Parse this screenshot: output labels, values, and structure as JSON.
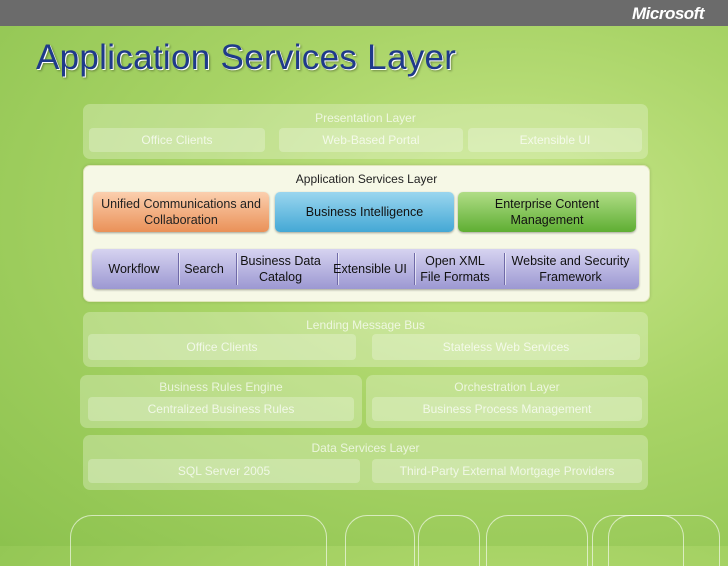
{
  "brand": "Microsoft",
  "title": "Application Services Layer",
  "presentation_layer": {
    "title": "Presentation Layer",
    "items": [
      "Office Clients",
      "Web-Based Portal",
      "Extensible UI"
    ]
  },
  "app_services": {
    "title": "Application Services Layer",
    "top_boxes": [
      "Unified Communications and Collaboration",
      "Business Intelligence",
      "Enterprise Content Management"
    ],
    "strip_items": [
      "Workflow",
      "Search",
      "Business Data Catalog",
      "Extensible UI",
      "Open XML File Formats",
      "Website and Security Framework"
    ]
  },
  "lending_bus": {
    "title": "Lending Message Bus",
    "items": [
      "Office Clients",
      "Stateless Web Services"
    ]
  },
  "business_rules": {
    "title": "Business Rules Engine",
    "item": "Centralized Business Rules"
  },
  "orchestration": {
    "title": "Orchestration Layer",
    "item": "Business Process Management"
  },
  "data_services": {
    "title": "Data Services Layer",
    "items": [
      "SQL Server 2005",
      "Third-Party External Mortgage Providers"
    ]
  },
  "colors": {
    "title": "#1f3a8a",
    "orange": "#ea9158",
    "blue": "#44a8d5",
    "green": "#5fae33",
    "strip": "#9c98d2"
  }
}
